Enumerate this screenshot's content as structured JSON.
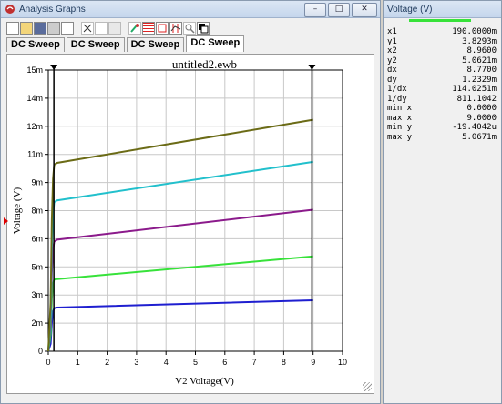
{
  "window": {
    "title": "Analysis Graphs",
    "buttons": {
      "minimize": "–",
      "restore": "□",
      "close": "✕"
    }
  },
  "toolbar": {
    "icons": [
      "new-icon",
      "open-icon",
      "save-icon",
      "print-icon",
      "print-preview-icon",
      "cut-icon",
      "copy-icon",
      "paste-icon",
      "properties-icon",
      "grid-icon",
      "legend-icon",
      "cursors-icon",
      "zoom-icon",
      "reverse-colors-icon"
    ]
  },
  "tabs": [
    {
      "label": "DC Sweep",
      "active": false
    },
    {
      "label": "DC Sweep",
      "active": false
    },
    {
      "label": "DC Sweep",
      "active": false
    },
    {
      "label": "DC Sweep",
      "active": true
    }
  ],
  "cursor_window": {
    "title": "Voltage (V)",
    "legend_color": "#37e23a",
    "rows": [
      {
        "key": "x1",
        "value": "190.0000m"
      },
      {
        "key": "y1",
        "value": "3.8293m"
      },
      {
        "key": "x2",
        "value": "8.9600"
      },
      {
        "key": "y2",
        "value": "5.0621m"
      },
      {
        "key": "dx",
        "value": "8.7700"
      },
      {
        "key": "dy",
        "value": "1.2329m"
      },
      {
        "key": "1/dx",
        "value": "114.0251m"
      },
      {
        "key": "1/dy",
        "value": "811.1042"
      },
      {
        "key": "min x",
        "value": "0.0000"
      },
      {
        "key": "max x",
        "value": "9.0000"
      },
      {
        "key": "min y",
        "value": "-19.4042u"
      },
      {
        "key": "max y",
        "value": "5.0671m"
      }
    ]
  },
  "chart_data": {
    "type": "line",
    "title": "untitled2.ewb",
    "xlabel": "V2 Voltage(V)",
    "ylabel": "Voltage (V)",
    "xlim": [
      0,
      10
    ],
    "ylim": [
      0,
      15
    ],
    "x_ticks": [
      "0",
      "1",
      "2",
      "3",
      "4",
      "5",
      "6",
      "7",
      "8",
      "9",
      "10"
    ],
    "y_ticks": [
      "0",
      "2m",
      "3m",
      "5m",
      "6m",
      "8m",
      "9m",
      "11m",
      "12m",
      "14m",
      "15m"
    ],
    "grid": true,
    "cursors_x": [
      0.19,
      8.96
    ],
    "series": [
      {
        "color": "#1f1fd0",
        "points": [
          [
            0,
            0
          ],
          [
            0.08,
            0.4
          ],
          [
            0.12,
            1.5
          ],
          [
            0.16,
            2.1
          ],
          [
            0.2,
            2.3
          ],
          [
            0.3,
            2.33
          ],
          [
            9,
            2.72
          ]
        ]
      },
      {
        "color": "#37e23a",
        "points": [
          [
            0,
            0
          ],
          [
            0.08,
            0.9
          ],
          [
            0.12,
            2.8
          ],
          [
            0.16,
            3.6
          ],
          [
            0.2,
            3.83
          ],
          [
            0.3,
            3.85
          ],
          [
            9,
            5.06
          ]
        ]
      },
      {
        "color": "#8b1a8b",
        "points": [
          [
            0,
            0
          ],
          [
            0.08,
            1.5
          ],
          [
            0.12,
            4.2
          ],
          [
            0.16,
            5.4
          ],
          [
            0.2,
            5.85
          ],
          [
            0.3,
            5.95
          ],
          [
            9,
            7.55
          ]
        ]
      },
      {
        "color": "#22c0cc",
        "points": [
          [
            0,
            0
          ],
          [
            0.08,
            2.0
          ],
          [
            0.12,
            5.6
          ],
          [
            0.16,
            7.3
          ],
          [
            0.2,
            7.95
          ],
          [
            0.3,
            8.05
          ],
          [
            9,
            10.1
          ]
        ]
      },
      {
        "color": "#6b6b16",
        "points": [
          [
            0,
            0
          ],
          [
            0.08,
            2.6
          ],
          [
            0.12,
            7.0
          ],
          [
            0.16,
            9.2
          ],
          [
            0.2,
            9.95
          ],
          [
            0.3,
            10.05
          ],
          [
            9,
            12.35
          ]
        ]
      }
    ]
  }
}
